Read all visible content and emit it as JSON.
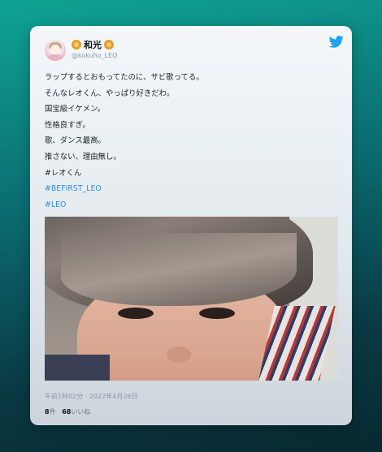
{
  "tweet": {
    "display_name": "和光",
    "handle": "@kokuho_LEO",
    "name_emoji": "lion-face-icon",
    "lines": [
      "ラップするとおもってたのに、サビ歌ってる。",
      "そんなレオくん、やっぱり好きだわ。",
      "国宝級イケメン。",
      "性格良すぎ。",
      "歌、ダンス最高。",
      "推さない、理由無し。",
      "#レオくん"
    ],
    "hashtags": [
      "#BEFIRST_LEO",
      "#LEO"
    ],
    "timestamp": "午前1時02分 · 2022年4月26日",
    "retweet_count": "8",
    "retweet_label": "件",
    "like_count": "68",
    "like_label": "いいね"
  },
  "colors": {
    "twitter_blue": "#1da1f2",
    "hashtag": "#2b8dd8"
  }
}
